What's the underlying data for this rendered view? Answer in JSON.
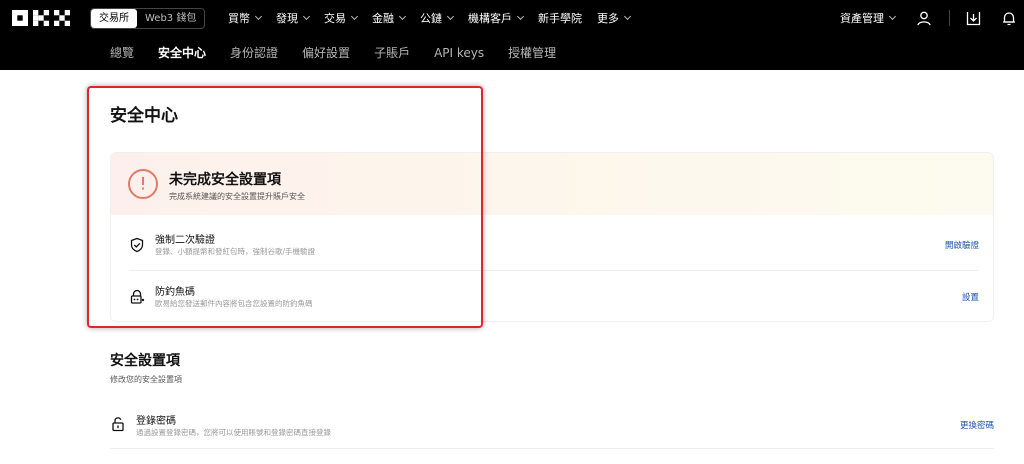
{
  "topbar": {
    "logo_text": "OKX",
    "mode": {
      "exchange": "交易所",
      "web3": "Web3 錢包"
    },
    "nav": [
      {
        "label": "買幣",
        "dropdown": true
      },
      {
        "label": "發現",
        "dropdown": true
      },
      {
        "label": "交易",
        "dropdown": true
      },
      {
        "label": "金融",
        "dropdown": true
      },
      {
        "label": "公鏈",
        "dropdown": true
      },
      {
        "label": "機構客戶",
        "dropdown": true
      },
      {
        "label": "新手學院",
        "dropdown": false
      },
      {
        "label": "更多",
        "dropdown": true
      }
    ],
    "asset_mgmt": "資產管理",
    "icons": [
      "user-icon",
      "download-icon",
      "bell-icon"
    ]
  },
  "subnav": {
    "tabs": [
      {
        "label": "總覽"
      },
      {
        "label": "安全中心",
        "active": true
      },
      {
        "label": "身份認證"
      },
      {
        "label": "偏好設置"
      },
      {
        "label": "子賬戶"
      },
      {
        "label": "API keys"
      },
      {
        "label": "授權管理"
      }
    ]
  },
  "page": {
    "title": "安全中心",
    "warning": {
      "title": "未完成安全設置項",
      "subtitle": "完成系統建議的安全設置提升賬戶安全",
      "items": [
        {
          "icon": "shield-check-icon",
          "label": "強制二次驗證",
          "desc": "登錄、小額提幣和發紅包時，強制谷歌/手機驗證",
          "action": "開啟驗證"
        },
        {
          "icon": "anti-phishing-lock-icon",
          "label": "防釣魚碼",
          "desc": "歐易給您發送郵件內容將包含您設置的防釣魚碼",
          "action": "設置"
        }
      ]
    },
    "security_items": {
      "title": "安全設置項",
      "subtitle": "修改您的安全設置項",
      "rows": [
        {
          "icon": "unlock-icon",
          "label": "登錄密碼",
          "desc": "通過設置登錄密碼，您將可以使用賬號和登錄密碼直接登錄",
          "action": "更換密碼"
        }
      ]
    }
  },
  "colors": {
    "topbar_bg": "#000000",
    "warning_accent": "#e07b6a",
    "link": "#1c4fa8",
    "annotation_box": "#e0262b"
  }
}
